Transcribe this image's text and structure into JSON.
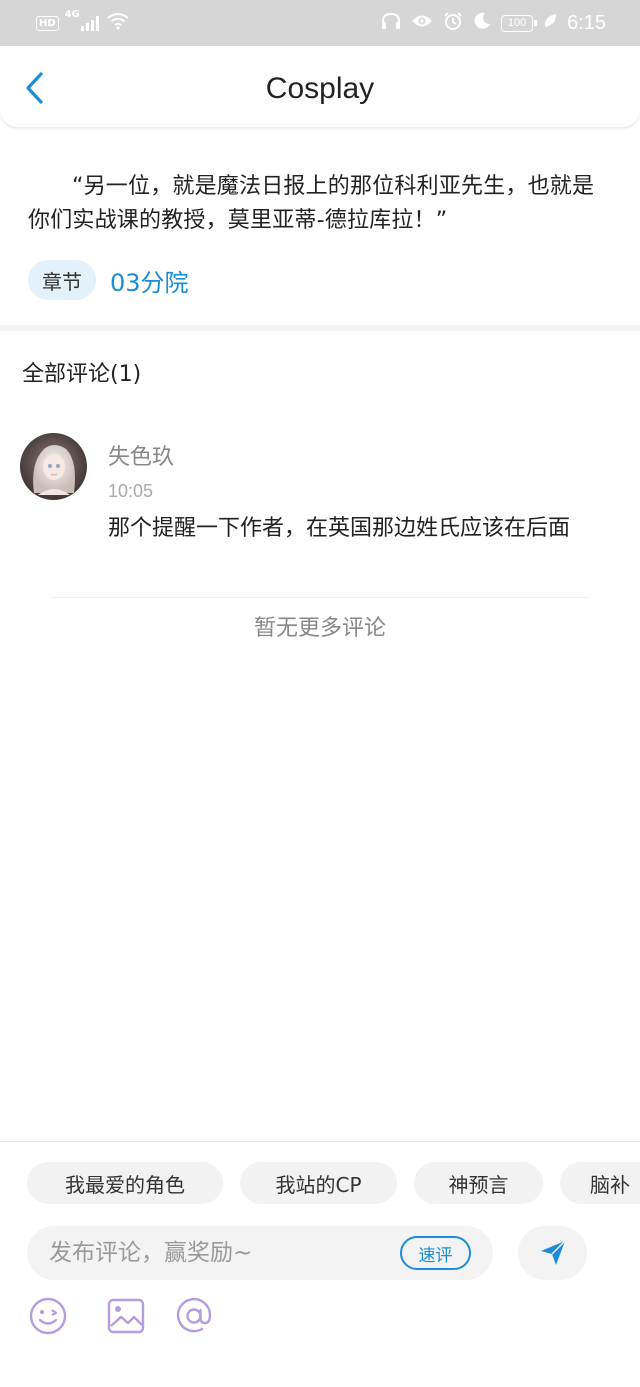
{
  "status_bar": {
    "hd": "HD",
    "network": "4G",
    "battery": "100",
    "time": "6:15"
  },
  "header": {
    "title": "Cosplay",
    "back_icon": "chevron-left-icon"
  },
  "quote": {
    "text": "“另一位，就是魔法日报上的那位科利亚先生，也就是你们实战课的教授，莫里亚蒂-德拉库拉！”"
  },
  "chapter": {
    "label": "章节",
    "name": "03分院"
  },
  "comments_section": {
    "title": "全部评论(1)",
    "items": [
      {
        "username": "失色玖",
        "time": "10:05",
        "text": "那个提醒一下作者，在英国那边姓氏应该在后面"
      }
    ],
    "no_more": "暂无更多评论"
  },
  "composer": {
    "quick_tags": [
      "我最爱的角色",
      "我站的CP",
      "神预言",
      "脑补"
    ],
    "placeholder": "发布评论，赢奖励~",
    "quick_review_label": "速评",
    "send_icon": "send-icon",
    "tools": [
      "emoji-icon",
      "image-icon",
      "mention-icon"
    ]
  },
  "colors": {
    "accent": "#1a8cd8",
    "tool_purple": "#b39de0",
    "chip_bg": "#e3f1fb",
    "status_bar_bg": "#d6d6d6"
  }
}
